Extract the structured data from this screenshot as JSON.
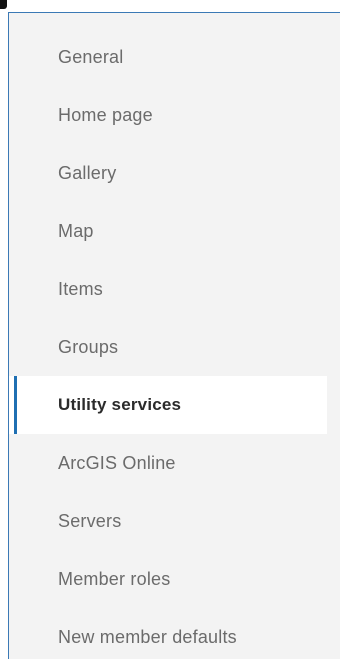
{
  "sidebar": {
    "items": [
      {
        "label": "General"
      },
      {
        "label": "Home page"
      },
      {
        "label": "Gallery"
      },
      {
        "label": "Map"
      },
      {
        "label": "Items"
      },
      {
        "label": "Groups"
      },
      {
        "label": "Utility services",
        "active": true
      },
      {
        "label": "ArcGIS Online"
      },
      {
        "label": "Servers"
      },
      {
        "label": "Member roles"
      },
      {
        "label": "New member defaults"
      }
    ]
  },
  "colors": {
    "panel_background": "#f3f3f3",
    "active_background": "#ffffff",
    "active_indicator": "#1f6fb2",
    "panel_border": "#3b79b5",
    "inactive_text": "#6b6b6b",
    "active_text": "#2b2b2b"
  }
}
